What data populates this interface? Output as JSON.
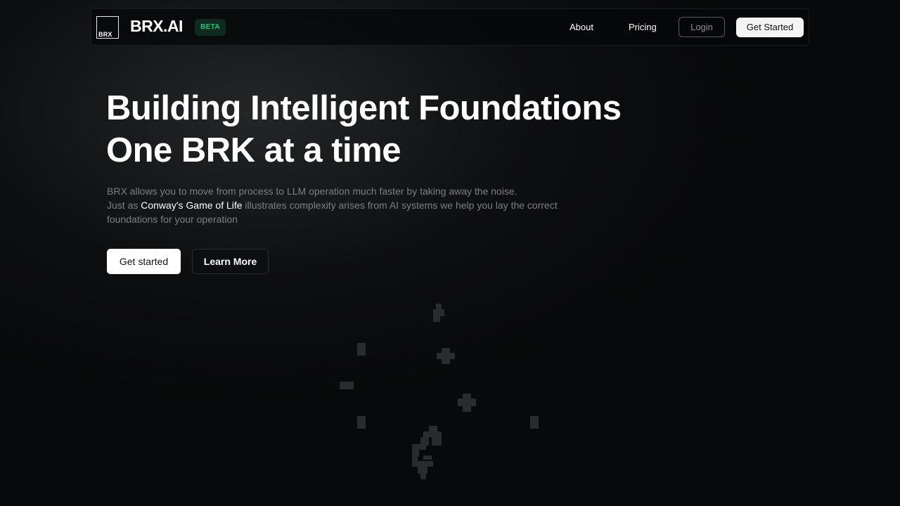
{
  "navbar": {
    "logo_text": "BRX",
    "brand_name": "BRX.AI",
    "badge": "BETA",
    "links": [
      {
        "label": "About"
      },
      {
        "label": "Pricing"
      }
    ],
    "login_label": "Login",
    "get_started_label": "Get Started"
  },
  "hero": {
    "title_line1": "Building Intelligent Foundations",
    "title_line2": "One BRK at a time",
    "desc_line1": "BRX allows you to move from process to LLM operation much faster by taking away the noise.",
    "desc_prefix": "Just as ",
    "desc_highlight": "Conway's Game of Life",
    "desc_suffix": " illustrates complexity arises from AI systems we help you lay the correct foundations for your operation",
    "primary_button": "Get started",
    "secondary_button": "Learn More"
  },
  "colors": {
    "background": "#08090a",
    "badge_bg": "#0f2a1e",
    "badge_text": "#2fbf7c",
    "muted_text": "#7d7f83",
    "life_cell": "#2a2b2d"
  }
}
